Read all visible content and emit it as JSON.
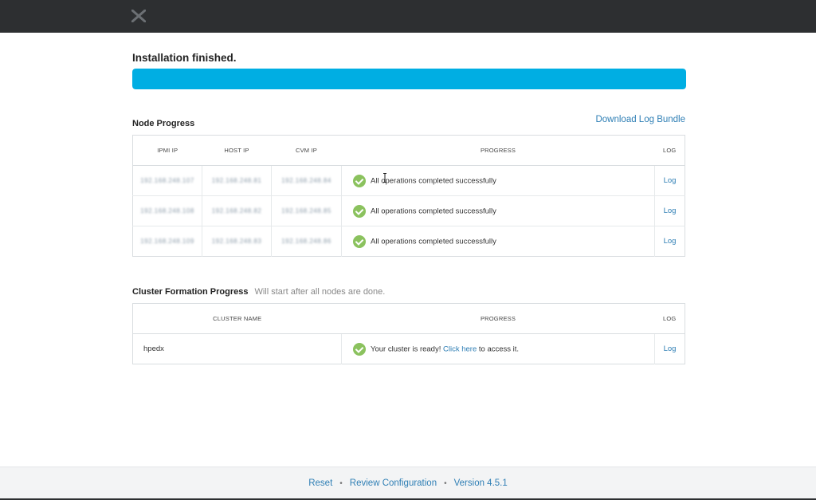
{
  "app": {
    "logo_icon": "x-logo-icon"
  },
  "status": {
    "title": "Installation finished.",
    "progress_percent": 100,
    "bar_color": "#00aee3"
  },
  "node_progress": {
    "title": "Node Progress",
    "download_link": "Download Log Bundle",
    "columns": [
      "IPMI IP",
      "HOST IP",
      "CVM IP",
      "PROGRESS",
      "LOG"
    ],
    "rows": [
      {
        "ipmi_ip": "192.168.248.107",
        "host_ip": "192.168.248.81",
        "cvm_ip": "192.168.248.84",
        "progress": "All operations completed successfully",
        "log": "Log"
      },
      {
        "ipmi_ip": "192.168.248.108",
        "host_ip": "192.168.248.82",
        "cvm_ip": "192.168.248.85",
        "progress": "All operations completed successfully",
        "log": "Log"
      },
      {
        "ipmi_ip": "192.168.248.109",
        "host_ip": "192.168.248.83",
        "cvm_ip": "192.168.248.86",
        "progress": "All operations completed successfully",
        "log": "Log"
      }
    ]
  },
  "cluster_progress": {
    "title": "Cluster Formation Progress",
    "subtitle": "Will start after all nodes are done.",
    "columns": [
      "CLUSTER NAME",
      "PROGRESS",
      "LOG"
    ],
    "rows": [
      {
        "name": "hpedx",
        "progress_prefix": "Your cluster is ready! ",
        "progress_link": "Click here",
        "progress_suffix": " to access it.",
        "log": "Log"
      }
    ]
  },
  "footer": {
    "reset": "Reset",
    "review": "Review Configuration",
    "version": "Version 4.5.1",
    "separator": "•"
  },
  "colors": {
    "topbar": "#2d2f31",
    "link": "#2f7fb5",
    "success": "#8bc25e"
  }
}
